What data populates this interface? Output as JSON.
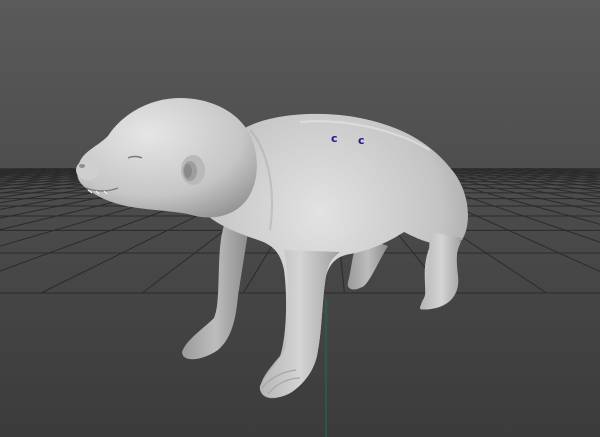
{
  "viewport": {
    "background_top": "#5a5a5a",
    "background_bottom": "#3b3b3b",
    "grid_color": "#2a2a2a",
    "axis_color": "#1f6b47",
    "model_color": "#bdbdbd"
  },
  "pivot_markers": [
    {
      "label": "c",
      "color": "#1a1a8a"
    },
    {
      "label": "c",
      "color": "#1a1a8a"
    }
  ]
}
